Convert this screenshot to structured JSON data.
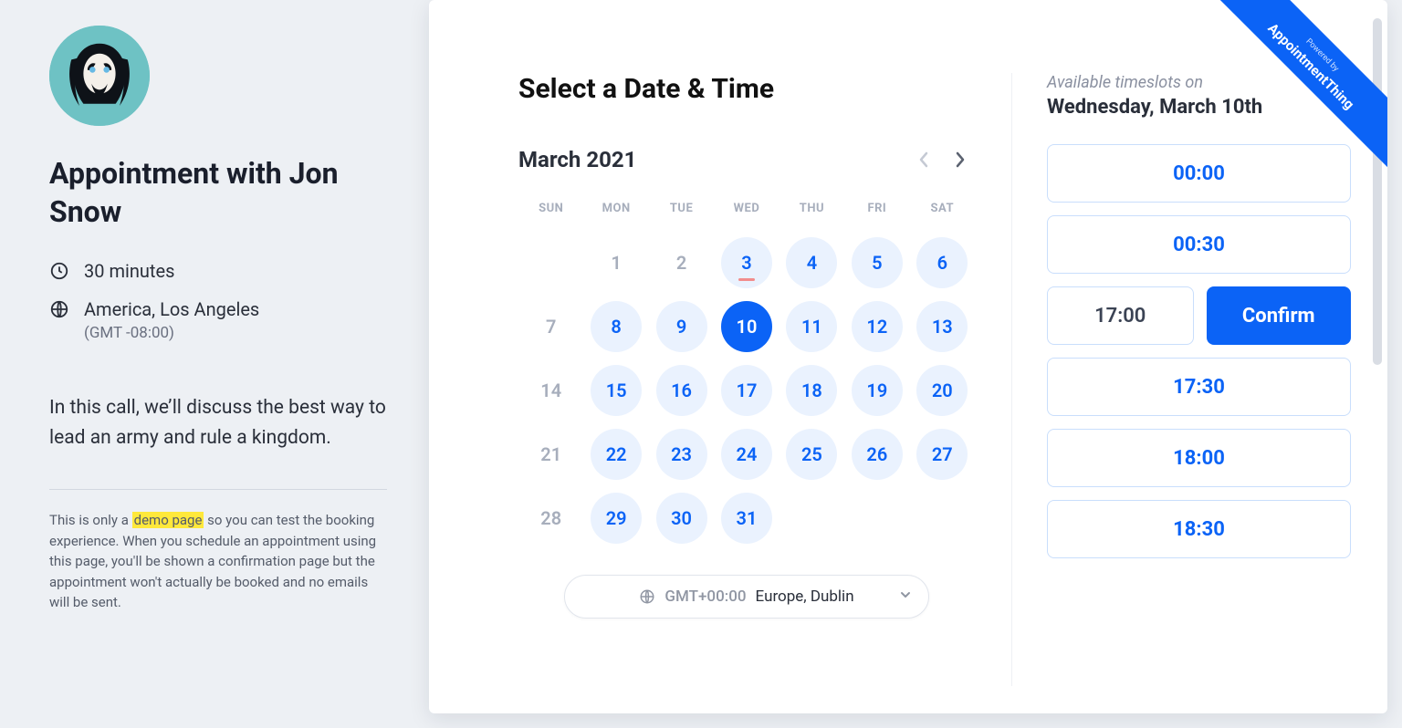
{
  "host": {
    "title": "Appointment with Jon Snow",
    "duration": "30 minutes",
    "location": "America, Los Angeles",
    "gmt_offset": "(GMT -08:00)",
    "description": "In this call, we’ll discuss the best way to lead an army and rule a kingdom.",
    "disclaimer_prefix": "This is only a ",
    "disclaimer_highlight": "demo page",
    "disclaimer_suffix": " so you can test the booking experience. When you schedule an appointment using this page, you'll be shown a confirmation page but the appointment won't actually be booked and no emails will be sent."
  },
  "panel_title": "Select a Date & Time",
  "calendar": {
    "month_label": "March 2021",
    "dow": [
      "SUN",
      "MON",
      "TUE",
      "WED",
      "THU",
      "FRI",
      "SAT"
    ],
    "weeks": [
      [
        {
          "d": "",
          "s": "empty"
        },
        {
          "d": "1",
          "s": "muted"
        },
        {
          "d": "2",
          "s": "muted"
        },
        {
          "d": "3",
          "s": "avail today"
        },
        {
          "d": "4",
          "s": "avail"
        },
        {
          "d": "5",
          "s": "avail"
        },
        {
          "d": "6",
          "s": "avail"
        }
      ],
      [
        {
          "d": "7",
          "s": "muted"
        },
        {
          "d": "8",
          "s": "avail"
        },
        {
          "d": "9",
          "s": "avail"
        },
        {
          "d": "10",
          "s": "selected"
        },
        {
          "d": "11",
          "s": "avail"
        },
        {
          "d": "12",
          "s": "avail"
        },
        {
          "d": "13",
          "s": "avail"
        }
      ],
      [
        {
          "d": "14",
          "s": "muted"
        },
        {
          "d": "15",
          "s": "avail"
        },
        {
          "d": "16",
          "s": "avail"
        },
        {
          "d": "17",
          "s": "avail"
        },
        {
          "d": "18",
          "s": "avail"
        },
        {
          "d": "19",
          "s": "avail"
        },
        {
          "d": "20",
          "s": "avail"
        }
      ],
      [
        {
          "d": "21",
          "s": "muted"
        },
        {
          "d": "22",
          "s": "avail"
        },
        {
          "d": "23",
          "s": "avail"
        },
        {
          "d": "24",
          "s": "avail"
        },
        {
          "d": "25",
          "s": "avail"
        },
        {
          "d": "26",
          "s": "avail"
        },
        {
          "d": "27",
          "s": "avail"
        }
      ],
      [
        {
          "d": "28",
          "s": "muted"
        },
        {
          "d": "29",
          "s": "avail"
        },
        {
          "d": "30",
          "s": "avail"
        },
        {
          "d": "31",
          "s": "avail"
        },
        {
          "d": "",
          "s": "empty"
        },
        {
          "d": "",
          "s": "empty"
        },
        {
          "d": "",
          "s": "empty"
        }
      ]
    ]
  },
  "timezone": {
    "prefix": "GMT+00:00",
    "label": "Europe, Dublin"
  },
  "slots": {
    "avail_label": "Available timeslots on",
    "date_label": "Wednesday, March 10th",
    "confirm_label": "Confirm",
    "items": [
      {
        "time": "00:00",
        "selected": false
      },
      {
        "time": "00:30",
        "selected": false
      },
      {
        "time": "17:00",
        "selected": true
      },
      {
        "time": "17:30",
        "selected": false
      },
      {
        "time": "18:00",
        "selected": false
      },
      {
        "time": "18:30",
        "selected": false
      }
    ]
  },
  "badge": {
    "small": "Powered by",
    "big": "AppointmentThing"
  }
}
